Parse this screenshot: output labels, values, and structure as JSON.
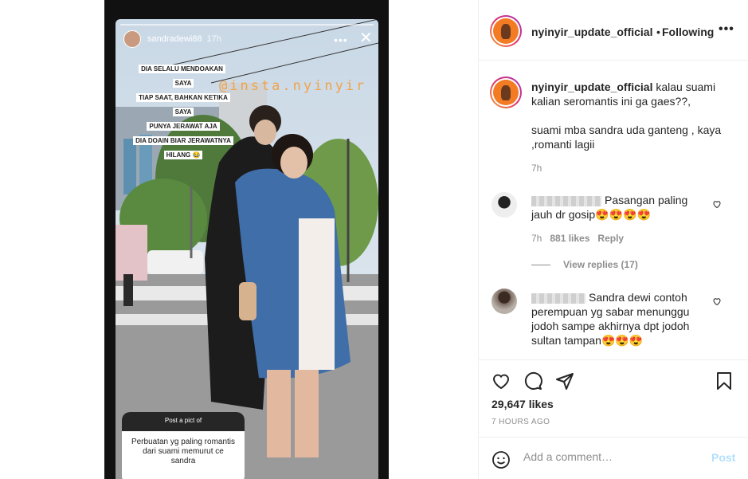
{
  "story": {
    "username": "sandradewi88",
    "time": "17h",
    "more": "•••",
    "close": "✕",
    "caption_lines": [
      "DIA SELALU MENDOAKAN SAYA",
      "TIAP SAAT, BAHKAN KETIKA SAYA",
      "PUNYA JERAWAT AJA",
      "DIA DOAIN BIAR JERAWATNYA",
      "HILANG 😂"
    ],
    "watermark": "@insta.nyinyir",
    "question_header": "Post a pict of",
    "question_body": "Perbuatan yg paling romantis dari suami memurut ce sandra"
  },
  "header": {
    "username": "nyinyir_update_official",
    "separator": "•",
    "follow_label": "Following",
    "more_label": "•••"
  },
  "caption": {
    "username": "nyinyir_update_official",
    "text1": "kalau suami kalian seromantis ini ga gaes??,",
    "text2": "suami mba sandra uda ganteng , kaya ,romanti lagii",
    "time": "7h"
  },
  "comments": [
    {
      "text": "Pasangan paling jauh dr gosip😍😍😍😍",
      "time": "7h",
      "likes": "881 likes",
      "reply": "Reply",
      "view_replies": "View replies (17)"
    },
    {
      "text": "Sandra dewi contoh perempuan yg sabar menunggu jodoh sampe akhirnya dpt jodoh sultan tampan😍😍😍"
    }
  ],
  "actions": {
    "likes": "29,647 likes",
    "age": "7 HOURS AGO",
    "comment_placeholder": "Add a comment…",
    "post_label": "Post"
  },
  "icons": [
    "heart-icon",
    "comment-icon",
    "share-icon",
    "bookmark-icon",
    "emoji-icon",
    "more-icon",
    "close-icon"
  ],
  "colors": {
    "link_blue_disabled": "#b2dffc",
    "muted": "#8e8e8e",
    "text": "#262626"
  }
}
